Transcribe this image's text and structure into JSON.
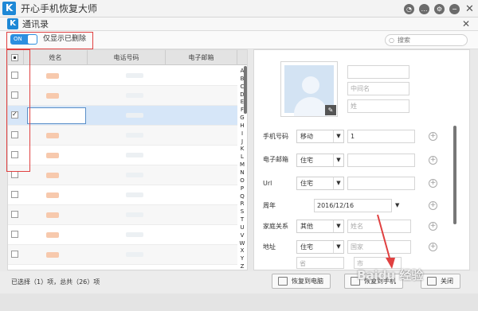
{
  "window": {
    "title": "开心手机恢复大师",
    "logo_letter": "K"
  },
  "panel": {
    "title": "通讯录",
    "logo_letter": "K"
  },
  "toolbar": {
    "toggle_label": "ON",
    "filter_label": "仅显示已删除",
    "search_placeholder": "搜索"
  },
  "list": {
    "columns": [
      "姓名",
      "电话号码",
      "电子邮箱"
    ],
    "row_count": 10,
    "selected_row": 3,
    "alphabet": [
      "A",
      "B",
      "C",
      "D",
      "E",
      "F",
      "G",
      "H",
      "I",
      "J",
      "K",
      "L",
      "M",
      "N",
      "O",
      "P",
      "Q",
      "R",
      "S",
      "T",
      "U",
      "V",
      "W",
      "X",
      "Y",
      "Z"
    ]
  },
  "detail": {
    "name_fields": [
      "",
      "中间名",
      "姓"
    ],
    "phone": {
      "label": "手机号码",
      "type": "移动",
      "value": "1"
    },
    "email": {
      "label": "电子邮箱",
      "type": "住宅"
    },
    "url": {
      "label": "Url",
      "type": "住宅"
    },
    "anniversary": {
      "label": "周年",
      "value": "2016/12/16"
    },
    "family": {
      "label": "家庭关系",
      "type": "其他",
      "placeholder": "姓名"
    },
    "address": {
      "label": "地址",
      "type": "住宅",
      "country_placeholder": "国家",
      "province_placeholder": "省",
      "city_placeholder": "市"
    }
  },
  "status": {
    "text": "已选择（1）项，总共（26）项"
  },
  "buttons": {
    "restore_pc": "恢复到电脑",
    "restore_phone": "恢复到手机",
    "close": "关闭"
  },
  "watermark": {
    "text": "Baidu 经验"
  },
  "colors": {
    "accent": "#1e88d6",
    "toggle": "#2c8fe0",
    "selected_row": "#d6e6f8",
    "highlight": "#e04040"
  }
}
